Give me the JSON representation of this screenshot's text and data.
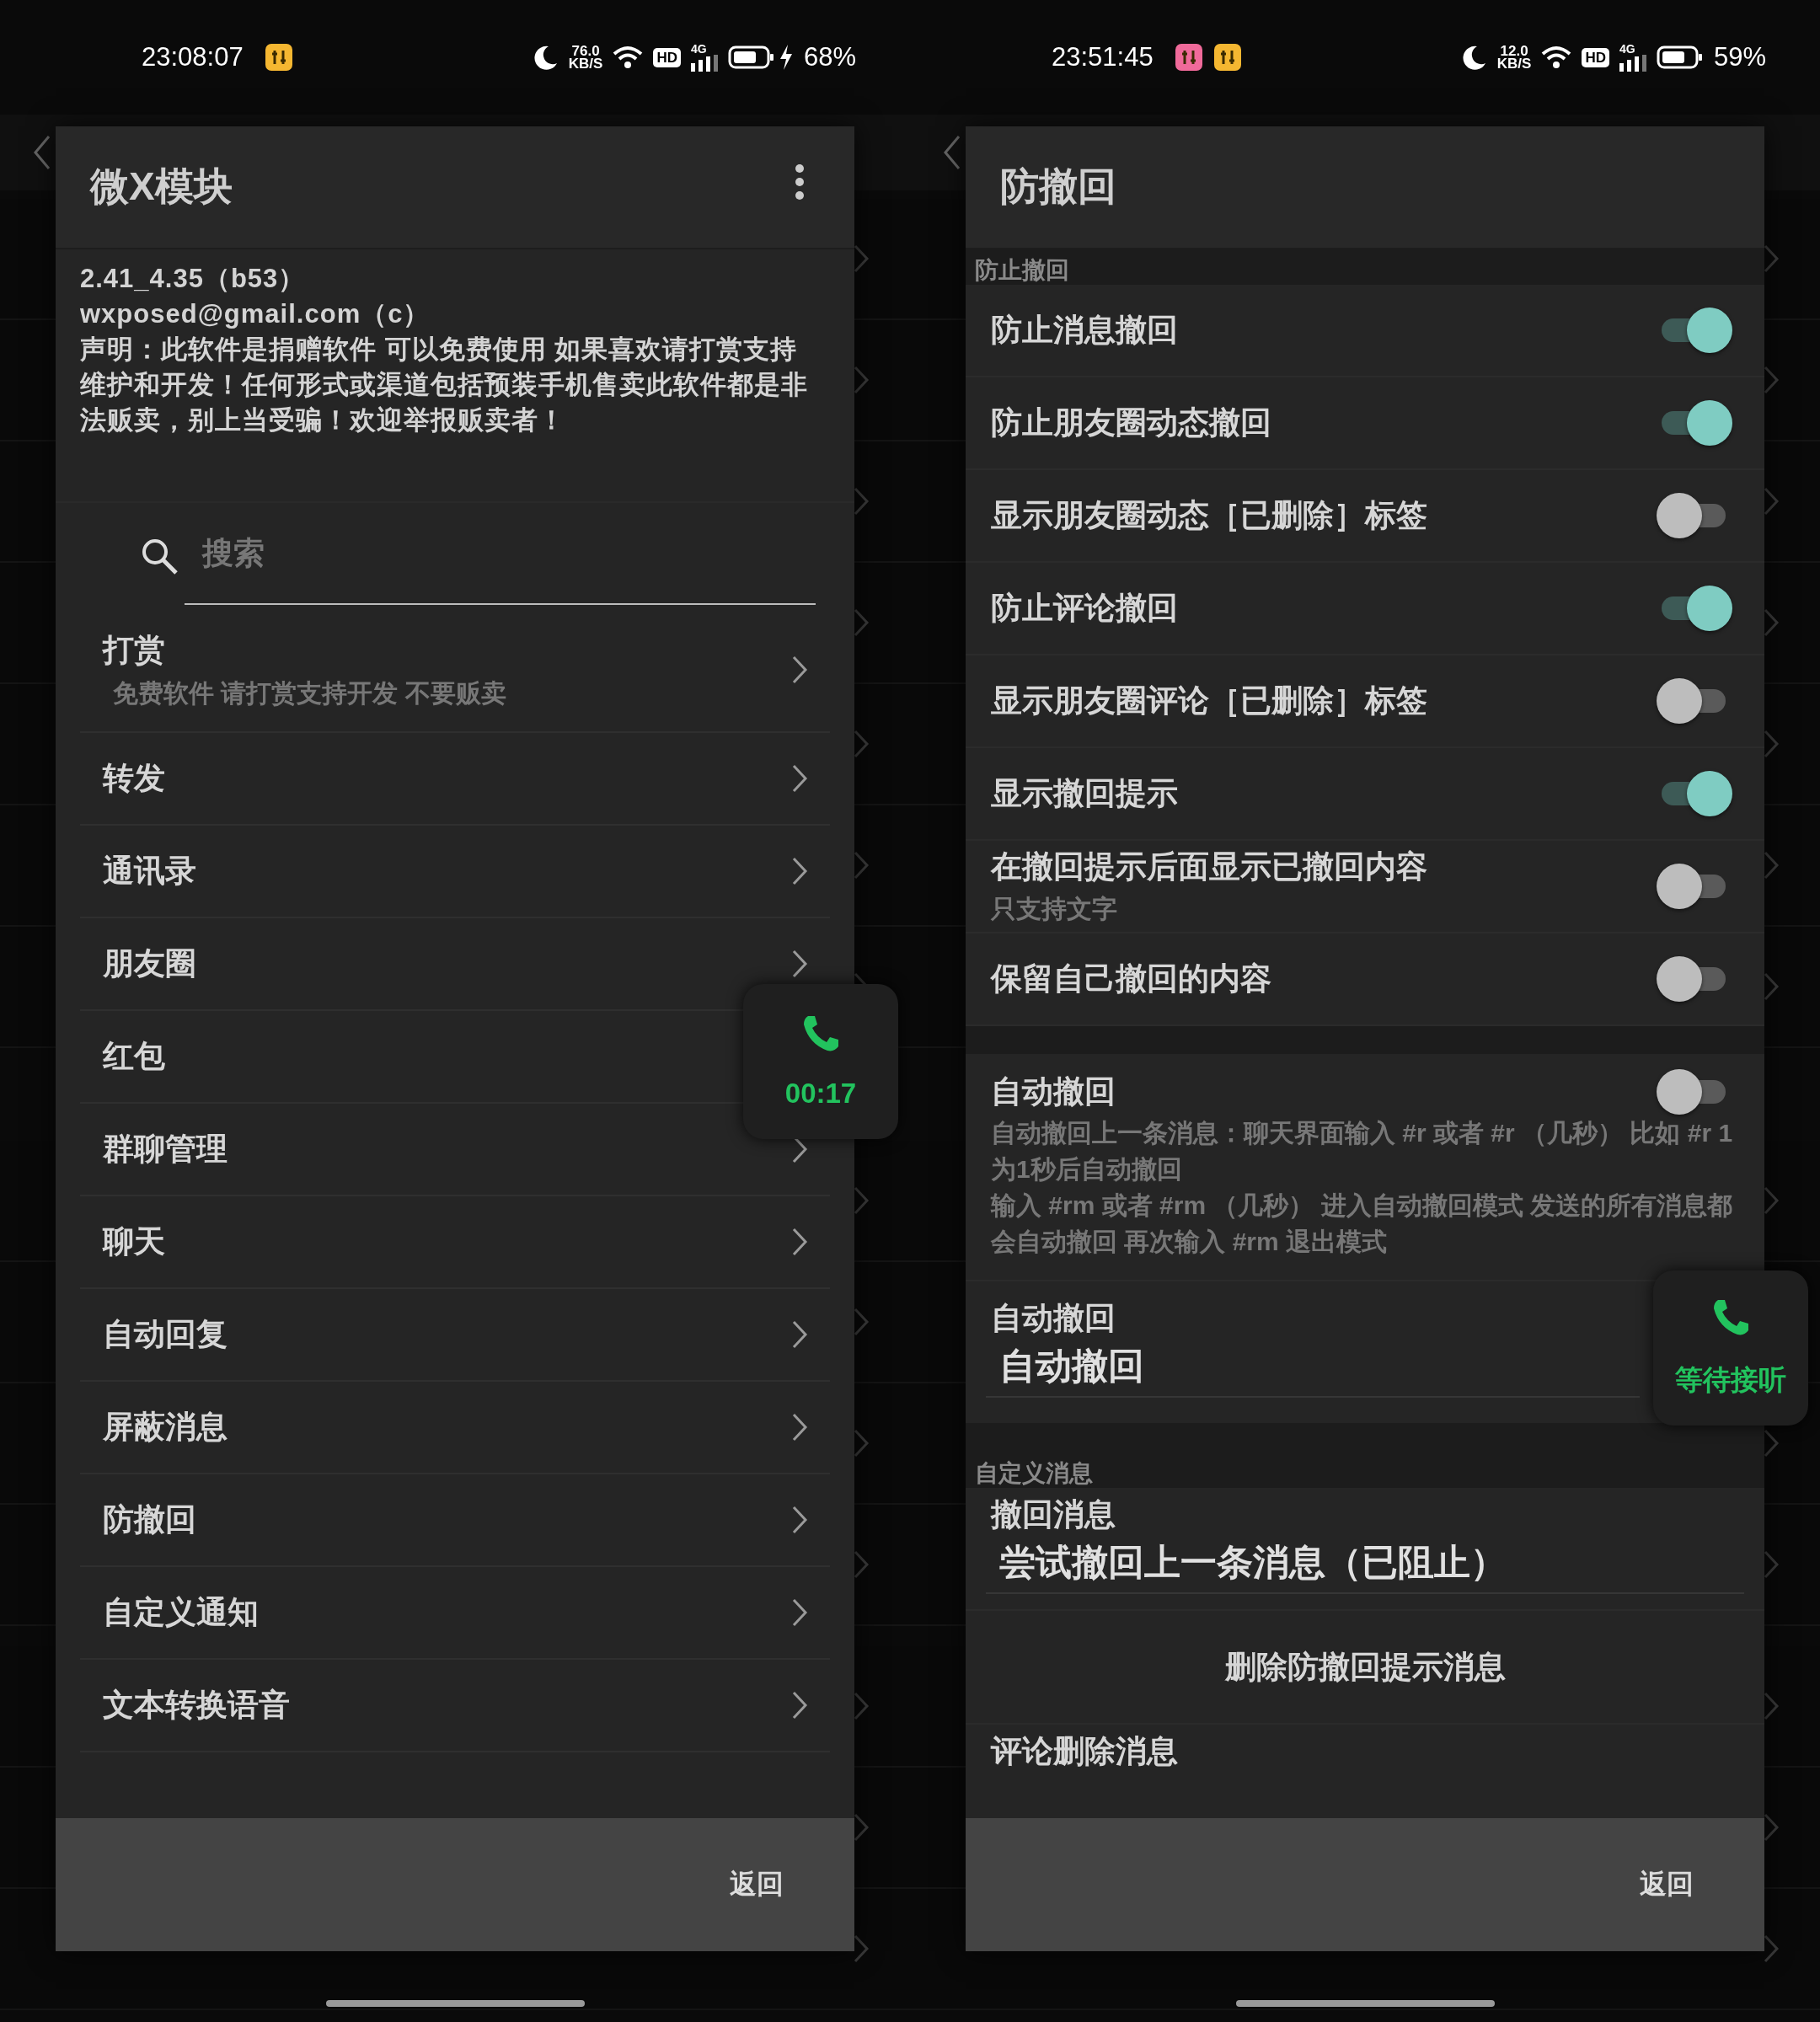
{
  "screens": [
    {
      "kind": "menu",
      "status_bar": {
        "time": "23:08:07",
        "app_icons": [
          {
            "color": "#f5b731"
          }
        ],
        "net_speed": "76.0",
        "net_unit": "KB/S",
        "hd": "HD",
        "network": "4G",
        "charging": true,
        "battery": "68%"
      },
      "dialog": {
        "title": "微X模块",
        "info": [
          "2.41_4.35（b53）",
          "wxposed@gmail.com（c）",
          "声明：此软件是捐赠软件 可以免费使用 如果喜欢请打赏支持维护和开发！任何形式或渠道包括预装手机售卖此软件都是非法贩卖，别上当受骗！欢迎举报贩卖者！"
        ],
        "search": {
          "placeholder": "搜索"
        },
        "items": [
          {
            "label": "打赏",
            "subtitle": "免费软件 请打赏支持开发 不要贩卖"
          },
          {
            "label": "转发"
          },
          {
            "label": "通讯录"
          },
          {
            "label": "朋友圈"
          },
          {
            "label": "红包"
          },
          {
            "label": "群聊管理"
          },
          {
            "label": "聊天"
          },
          {
            "label": "自动回复"
          },
          {
            "label": "屏蔽消息"
          },
          {
            "label": "防撤回"
          },
          {
            "label": "自定义通知"
          },
          {
            "label": "文本转换语音"
          }
        ],
        "footer_button": "返回"
      },
      "call": {
        "text": "00:17"
      }
    },
    {
      "kind": "settings",
      "status_bar": {
        "time": "23:51:45",
        "app_icons": [
          {
            "color": "#f06a9a"
          },
          {
            "color": "#f5b731"
          }
        ],
        "net_speed": "12.0",
        "net_unit": "KB/S",
        "hd": "HD",
        "network": "4G",
        "charging": false,
        "battery": "59%"
      },
      "dialog": {
        "title": "防撤回",
        "rows": [
          {
            "kind": "header",
            "label": "防止撤回"
          },
          {
            "kind": "switch",
            "label": "防止消息撤回",
            "on": true
          },
          {
            "kind": "switch",
            "label": "防止朋友圈动态撤回",
            "on": true
          },
          {
            "kind": "switch",
            "label": "显示朋友圈动态［已删除］标签",
            "on": false
          },
          {
            "kind": "switch",
            "label": "防止评论撤回",
            "on": true
          },
          {
            "kind": "switch",
            "label": "显示朋友圈评论［已删除］标签",
            "on": false
          },
          {
            "kind": "switch",
            "label": "显示撤回提示",
            "on": true
          },
          {
            "kind": "switch",
            "label": "在撤回提示后面显示已撤回内容",
            "subtitle": "只支持文字",
            "on": false
          },
          {
            "kind": "switch",
            "label": "保留自己撤回的内容",
            "on": false
          },
          {
            "kind": "gap"
          },
          {
            "kind": "switch",
            "label": "自动撤回",
            "description": [
              "自动撤回上一条消息：聊天界面输入 #r 或者 #r （几秒） 比如 #r 1 为1秒后自动撤回",
              "输入 #rm 或者 #rm （几秒） 进入自动撤回模式 发送的所有消息都会自动撤回 再次输入 #rm 退出模式"
            ],
            "on": false
          },
          {
            "kind": "edit",
            "label": "自动撤回",
            "value": "自动撤回"
          },
          {
            "kind": "header",
            "label": "自定义消息"
          },
          {
            "kind": "edit",
            "label": "撤回消息",
            "value": "尝试撤回上一条消息（已阻止）"
          },
          {
            "kind": "button",
            "label": "删除防撤回提示消息"
          },
          {
            "kind": "title",
            "label": "评论删除消息"
          }
        ],
        "footer_button": "返回"
      },
      "call": {
        "text": "等待接听"
      }
    }
  ]
}
